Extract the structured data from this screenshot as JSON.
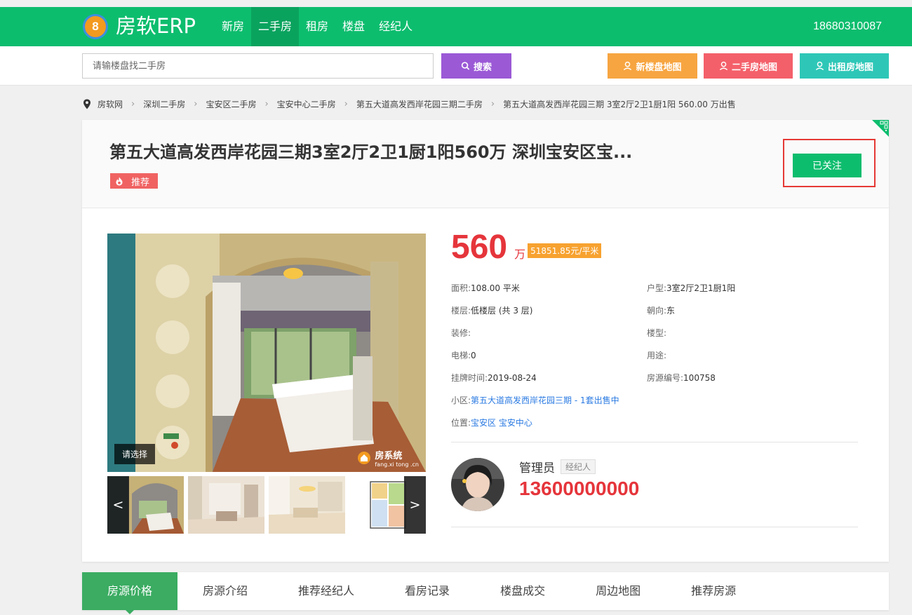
{
  "header": {
    "logo_digit": "8",
    "brand": "房软ERP",
    "nav": [
      {
        "label": "新房"
      },
      {
        "label": "二手房"
      },
      {
        "label": "租房"
      },
      {
        "label": "楼盘"
      },
      {
        "label": "经纪人"
      }
    ],
    "active_nav": "二手房",
    "phone": "18680310087"
  },
  "search": {
    "placeholder": "请输楼盘找二手房",
    "button": "搜索"
  },
  "map_buttons": {
    "new_house_map": "新楼盘地图",
    "second_hand_map": "二手房地图",
    "rental_map": "出租房地图"
  },
  "breadcrumb": [
    "房软网",
    "深圳二手房",
    "宝安区二手房",
    "宝安中心二手房",
    "第五大道高发西岸花园三期二手房",
    "第五大道高发西岸花园三期 3室2厅2卫1厨1阳 560.00 万出售"
  ],
  "listing": {
    "title": "第五大道高发西岸花园三期3室2厅2卫1厨1阳560万 深圳宝安区宝...",
    "tag": "推荐",
    "follow_button": "已关注",
    "photo_label": "请选择",
    "watermark": {
      "name": "房系统",
      "url": "fang.xi tong .cn"
    },
    "price": "560",
    "price_unit": "万",
    "unit_price": "51851.85元/平米",
    "details": {
      "area": {
        "label": "面积:",
        "value": "108.00 平米"
      },
      "layout": {
        "label": "户型:",
        "value": "3室2厅2卫1厨1阳"
      },
      "floor": {
        "label": "楼层:",
        "value": "低楼层 (共 3 层)"
      },
      "orientation": {
        "label": "朝向:",
        "value": "东"
      },
      "decoration": {
        "label": "装修:",
        "value": ""
      },
      "building_type": {
        "label": "楼型:",
        "value": ""
      },
      "elevator": {
        "label": "电梯:",
        "value": "0"
      },
      "usage": {
        "label": "用途:",
        "value": ""
      },
      "listed_date": {
        "label": "挂牌时间:",
        "value": "2019-08-24"
      },
      "listing_id": {
        "label": "房源编号:",
        "value": "100758"
      },
      "community": {
        "label": "小区:",
        "value": "第五大道高发西岸花园三期 - 1套出售中"
      },
      "location": {
        "label": "位置:",
        "value": "宝安区 宝安中心"
      }
    },
    "thumb_nav": {
      "prev": "<",
      "next": ">"
    }
  },
  "agent": {
    "name": "管理员",
    "role": "经纪人",
    "phone": "13600000000"
  },
  "tabs": [
    {
      "label": "房源价格"
    },
    {
      "label": "房源介绍"
    },
    {
      "label": "推荐经纪人"
    },
    {
      "label": "看房记录"
    },
    {
      "label": "楼盘成交"
    },
    {
      "label": "周边地图"
    },
    {
      "label": "推荐房源"
    }
  ],
  "colors": {
    "brand_green": "#0dbd6e",
    "price_red": "#e5353b",
    "search_purple": "#9b59d6",
    "orange": "#f7a541",
    "pink": "#f4606a",
    "teal": "#2ec7b7"
  }
}
